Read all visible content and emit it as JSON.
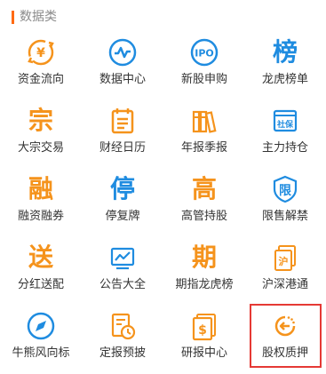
{
  "section": {
    "title": "数据类",
    "accent_color": "#ff6a13"
  },
  "colors": {
    "orange": "#f5931c",
    "blue": "#1f8ce0",
    "highlight": "#e53935"
  },
  "items": [
    {
      "label": "资金流向",
      "icon": "money-flow-icon"
    },
    {
      "label": "数据中心",
      "icon": "data-center-icon"
    },
    {
      "label": "新股申购",
      "icon": "ipo-icon",
      "icon_text": "IPO"
    },
    {
      "label": "龙虎榜单",
      "icon": "bang-icon",
      "icon_text": "榜"
    },
    {
      "label": "大宗交易",
      "icon": "zong-icon",
      "icon_text": "宗"
    },
    {
      "label": "财经日历",
      "icon": "calendar-icon"
    },
    {
      "label": "年报季报",
      "icon": "report-books-icon"
    },
    {
      "label": "主力持仓",
      "icon": "social-security-icon",
      "icon_text": "社保"
    },
    {
      "label": "融资融券",
      "icon": "rong-icon",
      "icon_text": "融"
    },
    {
      "label": "停复牌",
      "icon": "ting-icon",
      "icon_text": "停"
    },
    {
      "label": "高管持股",
      "icon": "gao-icon",
      "icon_text": "高"
    },
    {
      "label": "限售解禁",
      "icon": "xian-icon",
      "icon_text": "限"
    },
    {
      "label": "分红送配",
      "icon": "song-icon",
      "icon_text": "送"
    },
    {
      "label": "公告大全",
      "icon": "announcement-chart-icon"
    },
    {
      "label": "期指龙虎榜",
      "icon": "qi-icon",
      "icon_text": "期"
    },
    {
      "label": "沪深港通",
      "icon": "hu-icon",
      "icon_text": "沪"
    },
    {
      "label": "牛熊风向标",
      "icon": "compass-icon"
    },
    {
      "label": "定报预披",
      "icon": "schedule-report-icon"
    },
    {
      "label": "研报中心",
      "icon": "research-report-icon",
      "icon_text": "$"
    },
    {
      "label": "股权质押",
      "icon": "equity-pledge-icon"
    }
  ]
}
